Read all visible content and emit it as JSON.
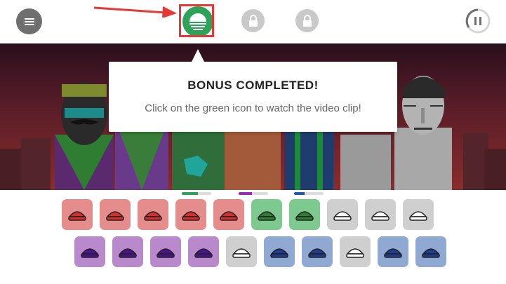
{
  "tooltip": {
    "title": "BONUS COMPLETED!",
    "message": "Click on the green icon to watch the video clip!"
  },
  "colors": {
    "bonus_green": "#2fa25a",
    "highlight_red": "#e53935",
    "beats_red": "#e58c8c",
    "effects_green": "#7dc98f",
    "melodies_purple": "#b98acb",
    "voices_blue": "#8fa9d3",
    "locked_grey": "#cfcfcf"
  },
  "toolbar": {
    "menu_icon": "menu-icon",
    "bonus_icon": "sunset-icon",
    "lock_icon": "lock-icon",
    "pause_icon": "pause-icon"
  },
  "progress_bars": [
    {
      "group": "beats",
      "fill": 0.55,
      "color": "#2fa25a"
    },
    {
      "group": "melodies",
      "fill": 0.45,
      "color": "#9c27b0"
    },
    {
      "group": "voices",
      "fill": 0.35,
      "color": "#1e5aa8"
    }
  ],
  "row1": [
    {
      "name": "red-hat-icon",
      "state": "active",
      "category": "beats"
    },
    {
      "name": "red-headphones-icon",
      "state": "active",
      "category": "beats"
    },
    {
      "name": "red-fedora-icon",
      "state": "active",
      "category": "beats"
    },
    {
      "name": "red-visor-icon",
      "state": "active",
      "category": "beats"
    },
    {
      "name": "red-sunglasses-icon",
      "state": "active",
      "category": "beats"
    },
    {
      "name": "green-hat-icon",
      "state": "active",
      "category": "effects"
    },
    {
      "name": "green-ball-icon",
      "state": "active",
      "category": "effects"
    },
    {
      "name": "grey-headband-icon",
      "state": "empty",
      "category": "effects"
    },
    {
      "name": "grey-stars-icon",
      "state": "empty",
      "category": "effects"
    },
    {
      "name": "grey-glasses-icon",
      "state": "empty",
      "category": "effects"
    }
  ],
  "row2": [
    {
      "name": "purple-shades-icon",
      "state": "active",
      "category": "melodies"
    },
    {
      "name": "purple-mask-icon",
      "state": "active",
      "category": "melodies"
    },
    {
      "name": "purple-hat-icon",
      "state": "active",
      "category": "melodies"
    },
    {
      "name": "purple-speaker-icon",
      "state": "active",
      "category": "melodies"
    },
    {
      "name": "grey-cap-icon",
      "state": "empty",
      "category": "melodies"
    },
    {
      "name": "blue-vortex-icon",
      "state": "active",
      "category": "voices"
    },
    {
      "name": "blue-goggles-icon",
      "state": "active",
      "category": "voices"
    },
    {
      "name": "grey-band-icon",
      "state": "empty",
      "category": "voices"
    },
    {
      "name": "blue-cap-icon",
      "state": "active",
      "category": "voices"
    },
    {
      "name": "blue-visor-cap-icon",
      "state": "active",
      "category": "voices"
    }
  ]
}
